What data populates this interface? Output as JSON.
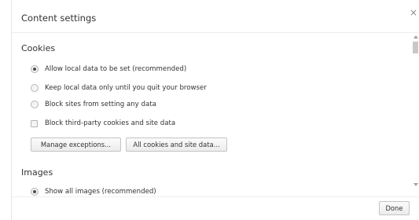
{
  "dialog": {
    "title": "Content settings",
    "close_glyph": "×"
  },
  "cookies": {
    "heading": "Cookies",
    "options": [
      {
        "label": "Allow local data to be set (recommended)",
        "type": "radio",
        "checked": true
      },
      {
        "label": "Keep local data only until you quit your browser",
        "type": "radio",
        "checked": false
      },
      {
        "label": "Block sites from setting any data",
        "type": "radio",
        "checked": false
      },
      {
        "label": "Block third-party cookies and site data",
        "type": "checkbox",
        "checked": false
      }
    ],
    "manage_exceptions_label": "Manage exceptions...",
    "all_cookies_label": "All cookies and site data..."
  },
  "images": {
    "heading": "Images",
    "partial_option_label": "Show all images (recommended)"
  },
  "footer": {
    "done_label": "Done"
  },
  "icons": {
    "close": "close-icon",
    "scroll_up": "scroll-up-arrow-icon",
    "scroll_down": "scroll-down-arrow-icon"
  }
}
